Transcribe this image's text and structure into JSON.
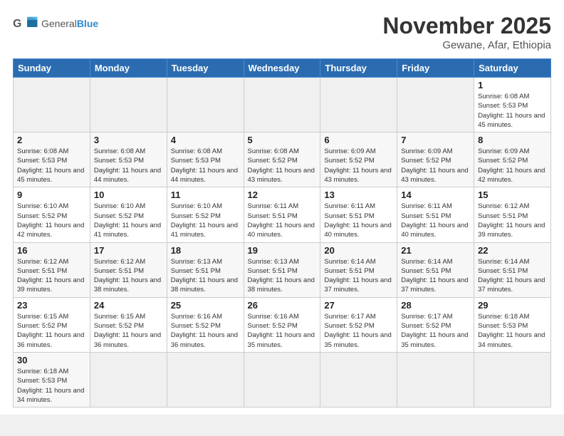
{
  "header": {
    "logo_text_general": "General",
    "logo_text_blue": "Blue",
    "title": "November 2025",
    "subtitle": "Gewane, Afar, Ethiopia"
  },
  "days_of_week": [
    "Sunday",
    "Monday",
    "Tuesday",
    "Wednesday",
    "Thursday",
    "Friday",
    "Saturday"
  ],
  "weeks": [
    [
      {
        "day": "",
        "info": ""
      },
      {
        "day": "",
        "info": ""
      },
      {
        "day": "",
        "info": ""
      },
      {
        "day": "",
        "info": ""
      },
      {
        "day": "",
        "info": ""
      },
      {
        "day": "",
        "info": ""
      },
      {
        "day": "1",
        "info": "Sunrise: 6:08 AM\nSunset: 5:53 PM\nDaylight: 11 hours\nand 45 minutes."
      }
    ],
    [
      {
        "day": "2",
        "info": "Sunrise: 6:08 AM\nSunset: 5:53 PM\nDaylight: 11 hours\nand 45 minutes."
      },
      {
        "day": "3",
        "info": "Sunrise: 6:08 AM\nSunset: 5:53 PM\nDaylight: 11 hours\nand 44 minutes."
      },
      {
        "day": "4",
        "info": "Sunrise: 6:08 AM\nSunset: 5:53 PM\nDaylight: 11 hours\nand 44 minutes."
      },
      {
        "day": "5",
        "info": "Sunrise: 6:08 AM\nSunset: 5:52 PM\nDaylight: 11 hours\nand 43 minutes."
      },
      {
        "day": "6",
        "info": "Sunrise: 6:09 AM\nSunset: 5:52 PM\nDaylight: 11 hours\nand 43 minutes."
      },
      {
        "day": "7",
        "info": "Sunrise: 6:09 AM\nSunset: 5:52 PM\nDaylight: 11 hours\nand 43 minutes."
      },
      {
        "day": "8",
        "info": "Sunrise: 6:09 AM\nSunset: 5:52 PM\nDaylight: 11 hours\nand 42 minutes."
      }
    ],
    [
      {
        "day": "9",
        "info": "Sunrise: 6:10 AM\nSunset: 5:52 PM\nDaylight: 11 hours\nand 42 minutes."
      },
      {
        "day": "10",
        "info": "Sunrise: 6:10 AM\nSunset: 5:52 PM\nDaylight: 11 hours\nand 41 minutes."
      },
      {
        "day": "11",
        "info": "Sunrise: 6:10 AM\nSunset: 5:52 PM\nDaylight: 11 hours\nand 41 minutes."
      },
      {
        "day": "12",
        "info": "Sunrise: 6:11 AM\nSunset: 5:51 PM\nDaylight: 11 hours\nand 40 minutes."
      },
      {
        "day": "13",
        "info": "Sunrise: 6:11 AM\nSunset: 5:51 PM\nDaylight: 11 hours\nand 40 minutes."
      },
      {
        "day": "14",
        "info": "Sunrise: 6:11 AM\nSunset: 5:51 PM\nDaylight: 11 hours\nand 40 minutes."
      },
      {
        "day": "15",
        "info": "Sunrise: 6:12 AM\nSunset: 5:51 PM\nDaylight: 11 hours\nand 39 minutes."
      }
    ],
    [
      {
        "day": "16",
        "info": "Sunrise: 6:12 AM\nSunset: 5:51 PM\nDaylight: 11 hours\nand 39 minutes."
      },
      {
        "day": "17",
        "info": "Sunrise: 6:12 AM\nSunset: 5:51 PM\nDaylight: 11 hours\nand 38 minutes."
      },
      {
        "day": "18",
        "info": "Sunrise: 6:13 AM\nSunset: 5:51 PM\nDaylight: 11 hours\nand 38 minutes."
      },
      {
        "day": "19",
        "info": "Sunrise: 6:13 AM\nSunset: 5:51 PM\nDaylight: 11 hours\nand 38 minutes."
      },
      {
        "day": "20",
        "info": "Sunrise: 6:14 AM\nSunset: 5:51 PM\nDaylight: 11 hours\nand 37 minutes."
      },
      {
        "day": "21",
        "info": "Sunrise: 6:14 AM\nSunset: 5:51 PM\nDaylight: 11 hours\nand 37 minutes."
      },
      {
        "day": "22",
        "info": "Sunrise: 6:14 AM\nSunset: 5:51 PM\nDaylight: 11 hours\nand 37 minutes."
      }
    ],
    [
      {
        "day": "23",
        "info": "Sunrise: 6:15 AM\nSunset: 5:52 PM\nDaylight: 11 hours\nand 36 minutes."
      },
      {
        "day": "24",
        "info": "Sunrise: 6:15 AM\nSunset: 5:52 PM\nDaylight: 11 hours\nand 36 minutes."
      },
      {
        "day": "25",
        "info": "Sunrise: 6:16 AM\nSunset: 5:52 PM\nDaylight: 11 hours\nand 36 minutes."
      },
      {
        "day": "26",
        "info": "Sunrise: 6:16 AM\nSunset: 5:52 PM\nDaylight: 11 hours\nand 35 minutes."
      },
      {
        "day": "27",
        "info": "Sunrise: 6:17 AM\nSunset: 5:52 PM\nDaylight: 11 hours\nand 35 minutes."
      },
      {
        "day": "28",
        "info": "Sunrise: 6:17 AM\nSunset: 5:52 PM\nDaylight: 11 hours\nand 35 minutes."
      },
      {
        "day": "29",
        "info": "Sunrise: 6:18 AM\nSunset: 5:53 PM\nDaylight: 11 hours\nand 34 minutes."
      }
    ],
    [
      {
        "day": "30",
        "info": "Sunrise: 6:18 AM\nSunset: 5:53 PM\nDaylight: 11 hours\nand 34 minutes."
      },
      {
        "day": "",
        "info": ""
      },
      {
        "day": "",
        "info": ""
      },
      {
        "day": "",
        "info": ""
      },
      {
        "day": "",
        "info": ""
      },
      {
        "day": "",
        "info": ""
      },
      {
        "day": "",
        "info": ""
      }
    ]
  ]
}
